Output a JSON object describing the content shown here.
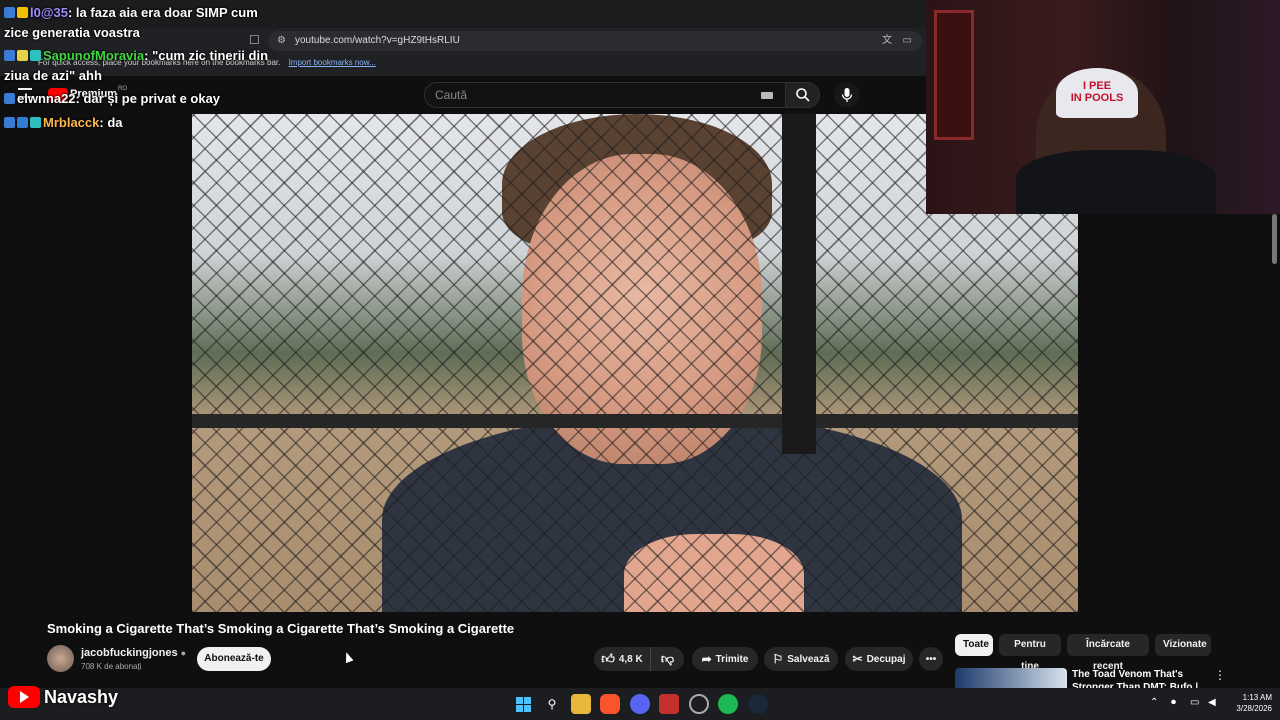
{
  "browser": {
    "url": "youtube.com/watch?v=gHZ9tHsRLIU",
    "bookmarks_hint": "For quick access, place your bookmarks here on the bookmarks bar.",
    "bookmarks_link": "Import bookmarks now..."
  },
  "youtube_header": {
    "premium_label": "Premium",
    "region": "RO",
    "search_placeholder": "Caută"
  },
  "chat": [
    {
      "user": "l0@35",
      "user_color": "#9b8cff",
      "message": ": la faza aia era doar SIMP cum"
    },
    {
      "user": "",
      "user_color": "#ffffff",
      "message": "zice generatia voastra"
    },
    {
      "user": "SapunofMoravia",
      "user_color": "#42d442",
      "message": ": \"cum zic tinerii din"
    },
    {
      "user": "",
      "user_color": "#ffffff",
      "message": "ziua de azi\" ahh"
    },
    {
      "user": "elwnna22",
      "user_color": "#ffffff",
      "message": ": dar și pe privat e okay"
    },
    {
      "user": "Mrblacck",
      "user_color": "#ffb84a",
      "message": ": da"
    }
  ],
  "webcam": {
    "hat_text": "I PEE\nIN POOLS"
  },
  "video": {
    "title": "Smoking a Cigarette That’s Smoking a Cigarette That’s Smoking a Cigarette",
    "channel": "jacobfuckingjones",
    "subscribers": "708 K de abonați",
    "subscribe_label": "Abonează-te",
    "likes": "4,8 K",
    "share_label": "Trimite",
    "save_label": "Salvează",
    "clip_label": "Decupaj"
  },
  "chips": [
    "Toate",
    "Pentru tine",
    "Încărcate recent",
    "Vizionate"
  ],
  "recommendation": {
    "title": "The Toad Venom That's Stronger Than DMT: Bufo | Hig"
  },
  "overlay": {
    "streamer": "Navashy"
  },
  "taskbar": {
    "time": "1:13 AM",
    "date": "3/28/2026"
  },
  "colors": {
    "accent_red": "#ff0000",
    "background": "#0f0f0f"
  }
}
